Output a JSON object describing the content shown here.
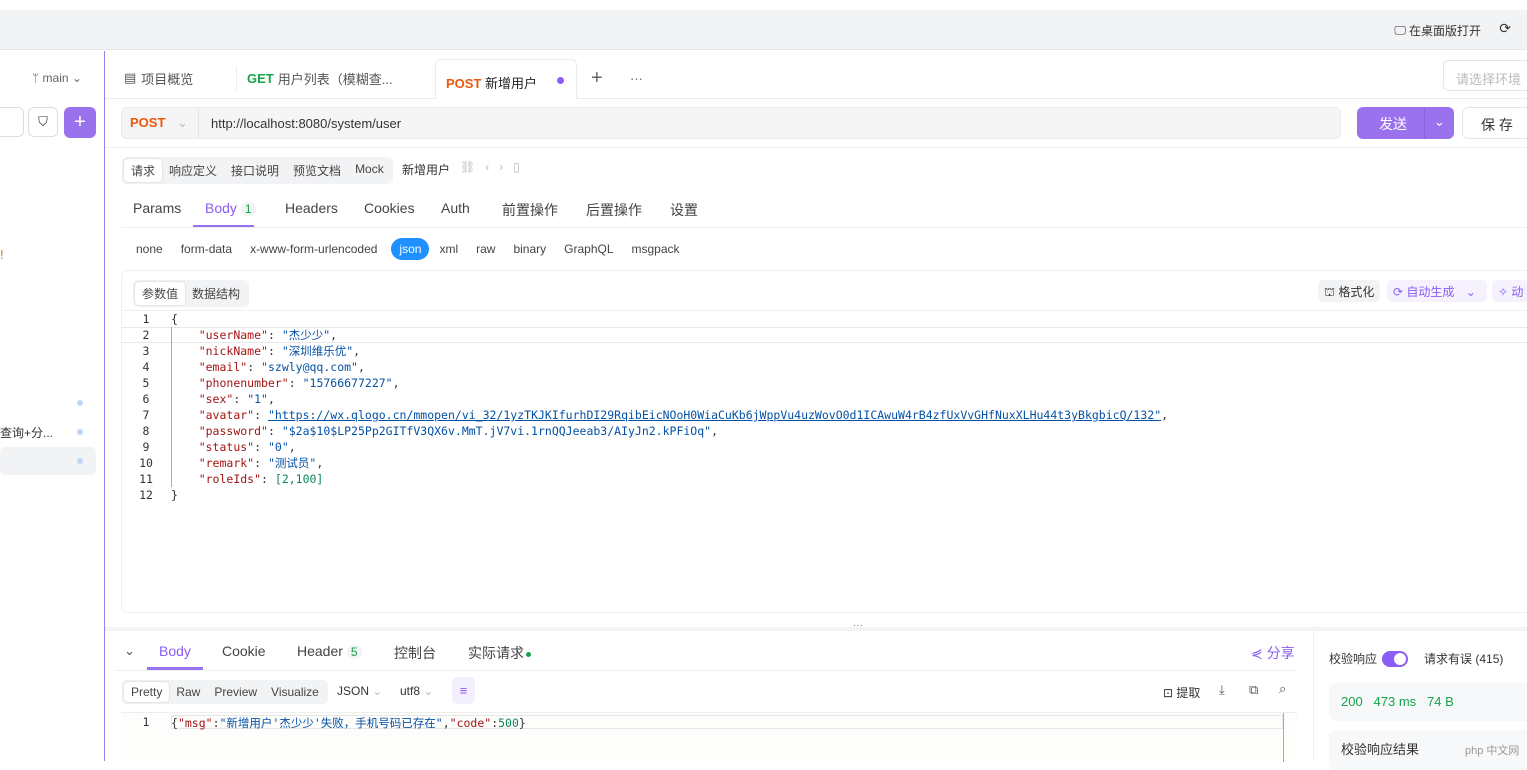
{
  "topbar": {
    "open_desktop": "在桌面版打开"
  },
  "sidebar": {
    "branch": "main",
    "item_partial": "查询+分...",
    "exclaim": "!"
  },
  "tabs": [
    {
      "label": "项目概览"
    },
    {
      "method": "GET",
      "label": "用户列表（模糊查..."
    },
    {
      "method": "POST",
      "label": "新增用户"
    }
  ],
  "env_placeholder": "请选择环境",
  "request": {
    "method": "POST",
    "url": "http://localhost:8080/system/user",
    "send": "发送",
    "save": "保 存"
  },
  "subtabs": [
    "请求",
    "响应定义",
    "接口说明",
    "预览文档",
    "Mock"
  ],
  "api_name": "新增用户",
  "param_tabs": [
    {
      "label": "Params"
    },
    {
      "label": "Body",
      "badge": "1"
    },
    {
      "label": "Headers"
    },
    {
      "label": "Cookies"
    },
    {
      "label": "Auth"
    },
    {
      "label": "前置操作"
    },
    {
      "label": "后置操作"
    },
    {
      "label": "设置"
    }
  ],
  "body_types": [
    "none",
    "form-data",
    "x-www-form-urlencoded",
    "json",
    "xml",
    "raw",
    "binary",
    "GraphQL",
    "msgpack"
  ],
  "editor_modes": [
    "参数值",
    "数据结构"
  ],
  "editor_tools": {
    "format": "格式化",
    "autogen": "自动生成",
    "dyn": "动"
  },
  "body_lines": [
    {
      "n": "1",
      "t": "{"
    },
    {
      "n": "2",
      "k": "userName",
      "v": "\"杰少少\""
    },
    {
      "n": "3",
      "k": "nickName",
      "v": "\"深圳维乐优\""
    },
    {
      "n": "4",
      "k": "email",
      "v": "\"szwly@qq.com\""
    },
    {
      "n": "5",
      "k": "phonenumber",
      "v": "\"15766677227\""
    },
    {
      "n": "6",
      "k": "sex",
      "v": "\"1\""
    },
    {
      "n": "7",
      "k": "avatar",
      "v": "\"https://wx.qlogo.cn/mmopen/vi_32/1yzTKJKIfurhDI29RqibEicNOoH0WiaCuKb6jWppVu4uzWovO0d1ICAwuW4rB4zfUxVvGHfNuxXLHu44t3yBkgbicQ/132\""
    },
    {
      "n": "8",
      "k": "password",
      "v": "\"$2a$10$LP25Pp2GITfV3QX6v.MmT.jV7vi.1rnQQJeeab3/AIyJn2.kPFiOq\""
    },
    {
      "n": "9",
      "k": "status",
      "v": "\"0\""
    },
    {
      "n": "10",
      "k": "remark",
      "v": "\"测试员\""
    },
    {
      "n": "11",
      "k": "roleIds",
      "v": "[2,100]"
    },
    {
      "n": "12",
      "t": "}"
    }
  ],
  "resp_tabs": [
    {
      "label": "Body"
    },
    {
      "label": "Cookie"
    },
    {
      "label": "Header",
      "badge": "5"
    },
    {
      "label": "控制台"
    },
    {
      "label": "实际请求"
    }
  ],
  "share": "分享",
  "resp_modes": [
    "Pretty",
    "Raw",
    "Preview",
    "Visualize"
  ],
  "resp_format": "JSON",
  "resp_encoding": "utf8",
  "resp_tools": {
    "extract": "提取"
  },
  "resp_line": {
    "n": "1",
    "text": "{\"msg\":\"新增用户'杰少少'失败，手机号码已存在\",\"code\":500}"
  },
  "validate": {
    "label": "校验响应",
    "error": "请求有误 (415)",
    "status": "200",
    "time": "473 ms",
    "size": "74 B",
    "result": "校验响应结果"
  },
  "watermark": "php 中文网"
}
